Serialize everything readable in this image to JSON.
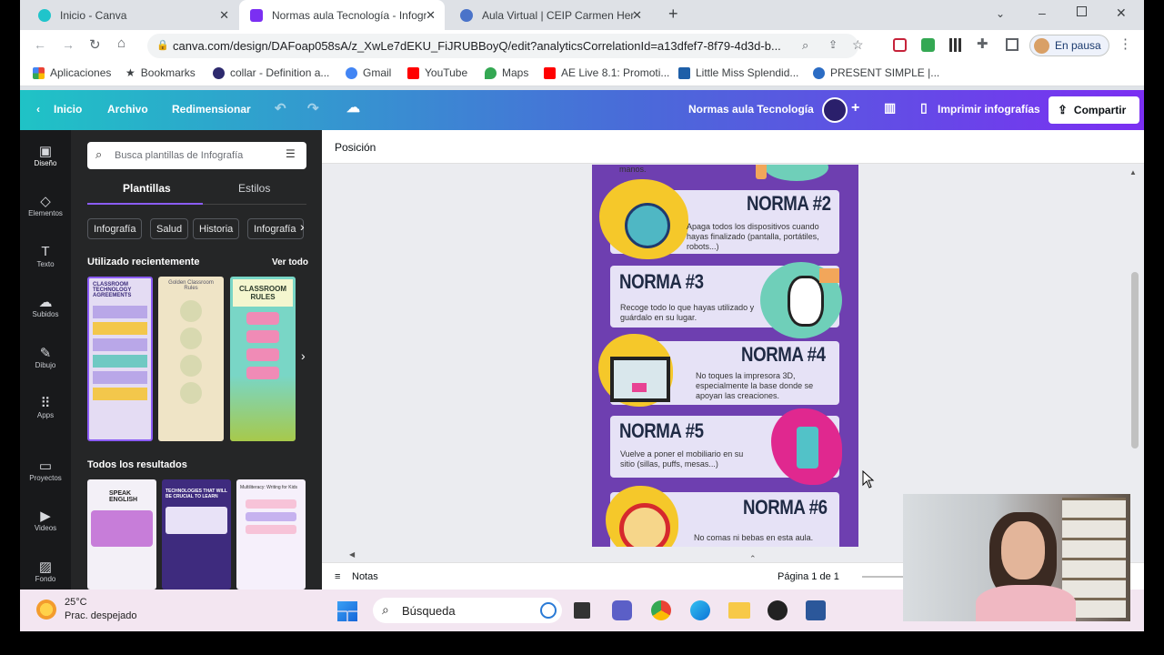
{
  "browser": {
    "tabs": [
      {
        "title": "Inicio - Canva",
        "active": false
      },
      {
        "title": "Normas aula Tecnología - Infogr",
        "active": true
      },
      {
        "title": "Aula Virtual | CEIP Carmen Hern",
        "active": false
      }
    ],
    "url": "canva.com/design/DAFoap058sA/z_XwLe7dEKU_FiJRUBBoyQ/edit?analyticsCorrelationId=a13dfef7-8f79-4d3d-b...",
    "profile_label": "En pausa",
    "bookmarks": [
      "Aplicaciones",
      "Bookmarks",
      "collar - Definition a...",
      "Gmail",
      "YouTube",
      "Maps",
      "AE Live 8.1: Promoti...",
      "Little Miss Splendid...",
      "PRESENT SIMPLE |..."
    ]
  },
  "canva": {
    "header": {
      "home": "Inicio",
      "file": "Archivo",
      "resize": "Redimensionar",
      "doc_title": "Normas aula Tecnología",
      "print": "Imprimir infografías",
      "share": "Compartir"
    },
    "rail": [
      "Diseño",
      "Elementos",
      "Texto",
      "Subidos",
      "Dibujo",
      "Apps",
      "Proyectos",
      "Videos",
      "Fondo"
    ],
    "panel": {
      "search_placeholder": "Busca plantillas de Infografía",
      "tabs": [
        "Plantillas",
        "Estilos"
      ],
      "chips": [
        "Infografía",
        "Salud",
        "Historia",
        "Infografía"
      ],
      "recent_title": "Utilizado recientemente",
      "see_all": "Ver todo",
      "all_results": "Todos los resultados",
      "thumb_texts": [
        "CLASSROOM TECHNOLOGY AGREEMENTS",
        "Golden Classroom Rules",
        "CLASSROOM RULES",
        "SPEAK ENGLISH",
        "TECHNOLOGIES THAT WILL BE CRUCIAL TO LEARN",
        "Multiliteracy: Writing for Kids"
      ]
    },
    "toolbar": {
      "position": "Posición"
    },
    "infographic": {
      "top_fragment": "manos.",
      "rules": [
        {
          "title": "NORMA #2",
          "text": "Apaga todos los dispositivos cuando hayas finalizado (pantalla, portátiles, robots...)"
        },
        {
          "title": "NORMA #3",
          "text": "Recoge todo lo que hayas utilizado y guárdalo en su lugar."
        },
        {
          "title": "NORMA #4",
          "text": "No toques la impresora 3D, especialmente la base donde se apoyan las creaciones."
        },
        {
          "title": "NORMA #5",
          "text": "Vuelve a poner el mobiliario en su sitio (sillas, puffs, mesas...)"
        },
        {
          "title": "NORMA #6",
          "text": "No comas ni bebas en esta aula."
        }
      ]
    },
    "footer": {
      "notes": "Notas",
      "page": "Página 1 de 1"
    }
  },
  "taskbar": {
    "temp": "25°C",
    "weather": "Prac. despejado",
    "search": "Búsqueda"
  },
  "colors": {
    "infographic_bg": "#6e3fb0",
    "card_bg": "#e6e2f6",
    "header_start": "#1fc3c6",
    "header_end": "#7b2ff2"
  }
}
